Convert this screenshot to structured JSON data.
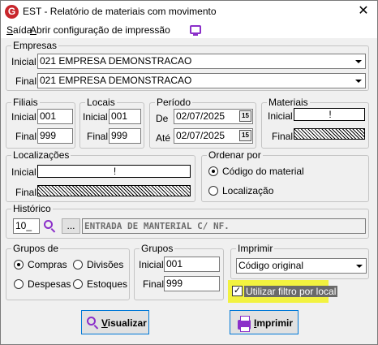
{
  "window": {
    "title": "EST -  Relatório de materiais com movimento",
    "logo_text": "G",
    "close": "✕"
  },
  "menu": {
    "exit_label": "Saída",
    "exit_hotkey": "S",
    "print_config_label": "Abrir configuração de impressão",
    "print_config_hotkey": "A"
  },
  "empresas": {
    "title": "Empresas",
    "initial_label": "Inicial",
    "initial_value": "021 EMPRESA DEMONSTRACAO",
    "final_label": "Final",
    "final_value": "021 EMPRESA DEMONSTRACAO"
  },
  "filiais": {
    "title": "Filiais",
    "initial_label": "Inicial",
    "initial_value": "001",
    "final_label": "Final",
    "final_value": "999"
  },
  "locais": {
    "title": "Locais",
    "initial_label": "Inicial",
    "initial_value": "001",
    "final_label": "Final",
    "final_value": "999"
  },
  "periodo": {
    "title": "Período",
    "from_label": "De",
    "from_value": "02/07/2025",
    "to_label": "Até",
    "to_value": "02/07/2025",
    "cal_icon": "15"
  },
  "materiais": {
    "title": "Materiais",
    "initial_label": "Inicial",
    "initial_value": "!",
    "final_label": "Final"
  },
  "localizacoes": {
    "title": "Localizações",
    "initial_label": "Inicial",
    "initial_value": "!",
    "final_label": "Final"
  },
  "ordenar": {
    "title": "Ordenar por",
    "options": [
      "Código do material",
      "Localização"
    ],
    "selected": 0
  },
  "historico": {
    "title": "Histórico",
    "code": "10_",
    "ellipsis": "...",
    "description": "ENTRADA DE MANTERIAL C/ NF."
  },
  "grupos_de": {
    "title": "Grupos de",
    "options": [
      "Compras",
      "Divisões",
      "Despesas",
      "Estoques"
    ],
    "selected": 0
  },
  "grupos": {
    "title": "Grupos",
    "initial_label": "Inicial",
    "initial_value": "001",
    "final_label": "Final",
    "final_value": "999"
  },
  "imprimir": {
    "title": "Imprimir",
    "selected": "Código original"
  },
  "filter_checkbox": {
    "label": "Utilizar filtro por local",
    "checked": true,
    "check_mark": "✓"
  },
  "buttons": {
    "visualizar_label": "Visualizar",
    "imprimir_label": "Imprimir"
  }
}
